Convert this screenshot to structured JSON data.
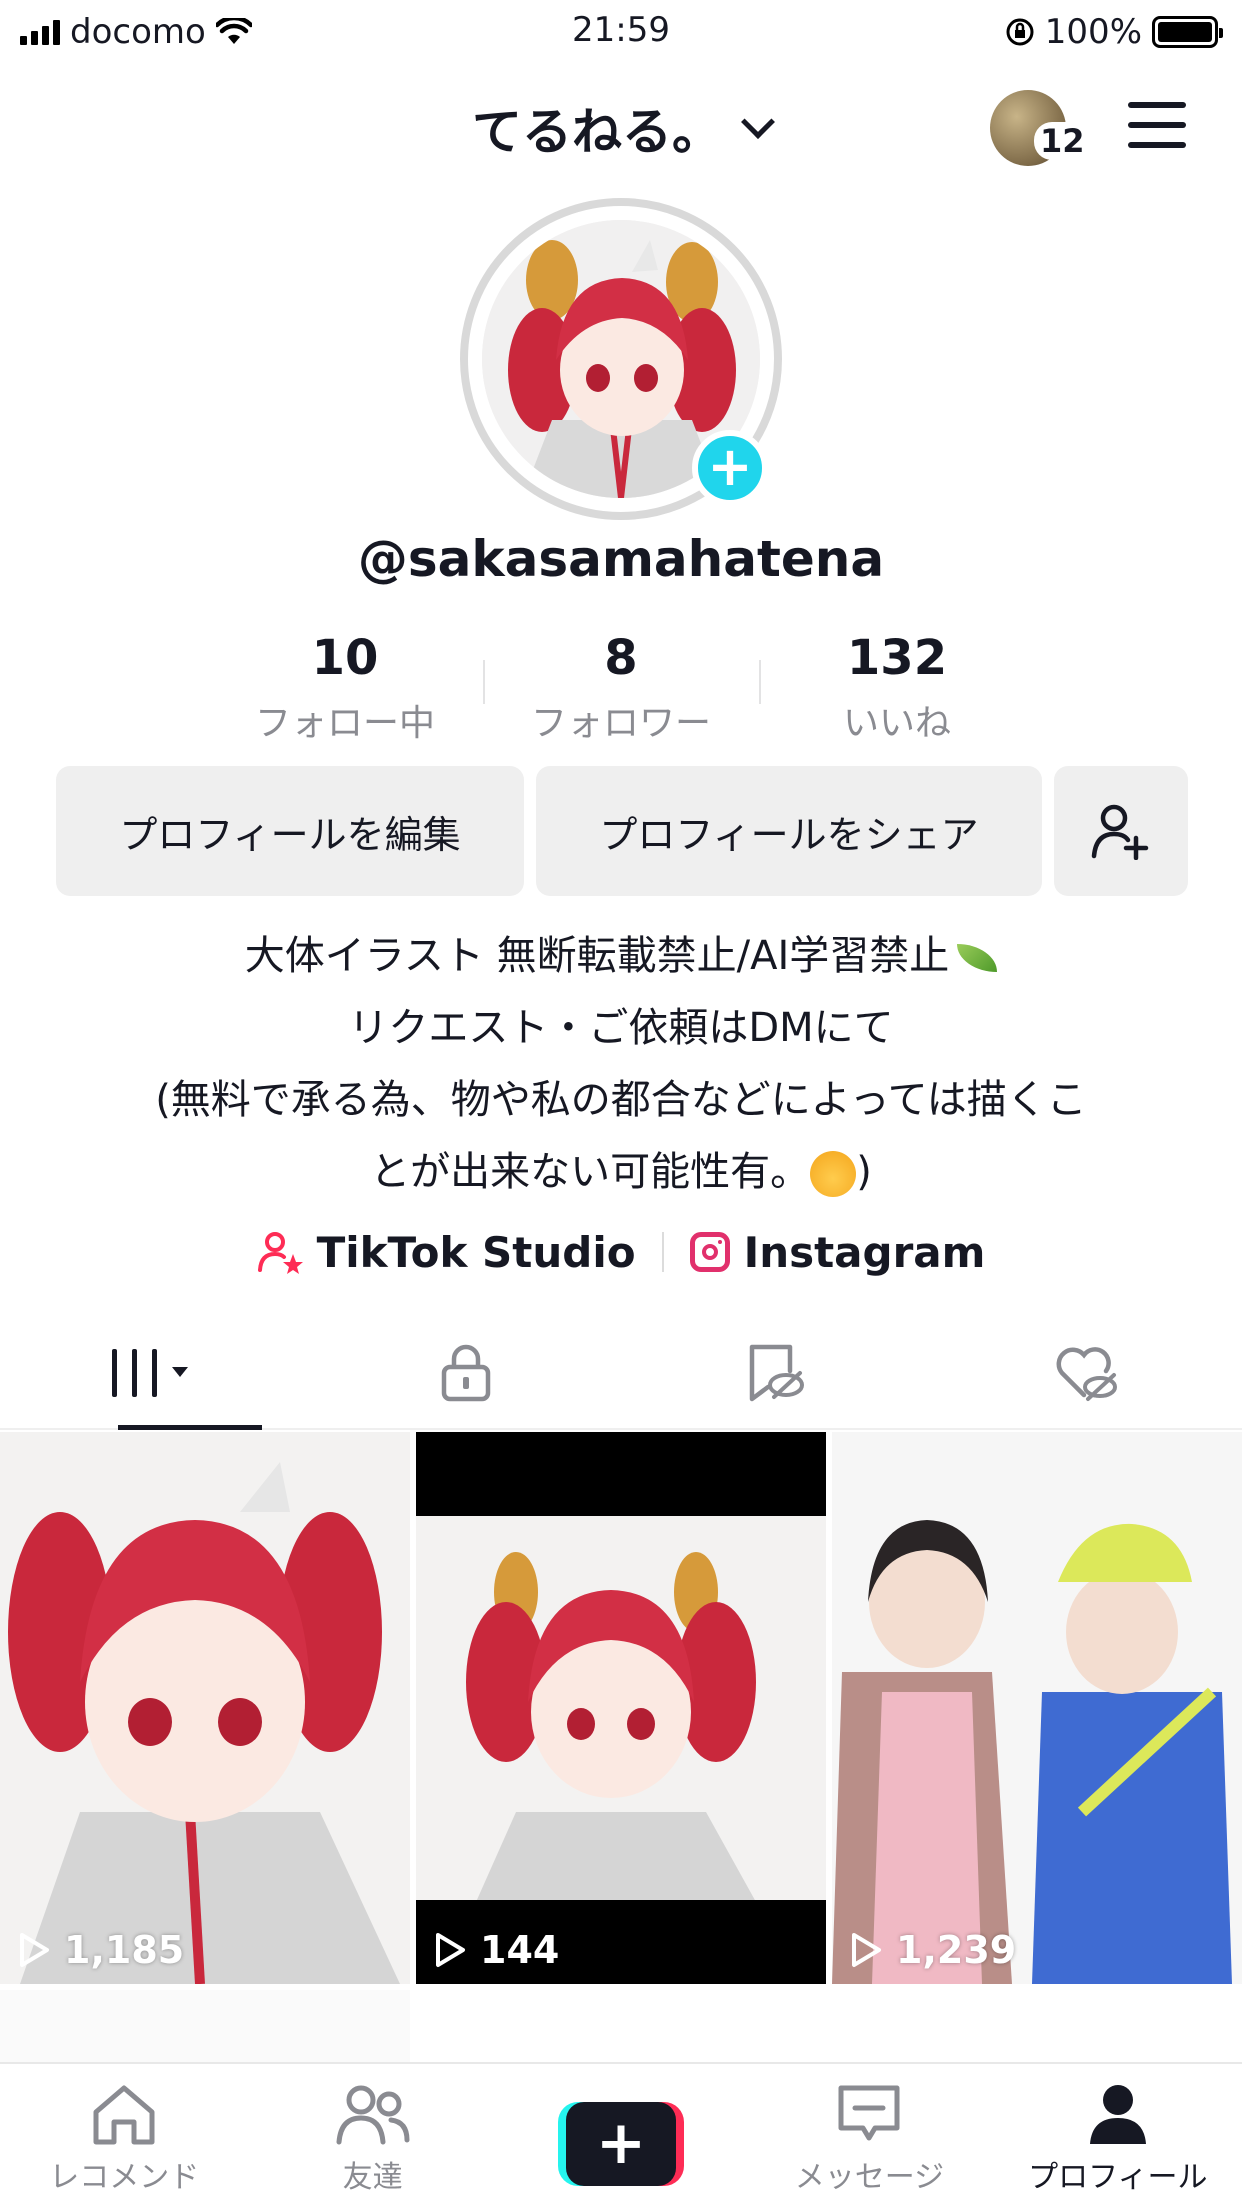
{
  "status_bar": {
    "carrier": "docomo",
    "time": "21:59",
    "battery": "100%"
  },
  "header": {
    "title": "てるねる。",
    "notification_count": "12"
  },
  "profile": {
    "username": "@sakasamahatena",
    "stats": [
      {
        "value": "10",
        "label": "フォロー中"
      },
      {
        "value": "8",
        "label": "フォロワー"
      },
      {
        "value": "132",
        "label": "いいね"
      }
    ],
    "buttons": {
      "edit": "プロフィールを編集",
      "share": "プロフィールをシェア"
    },
    "bio": [
      "大体イラスト 無断転載禁止/AI学習禁止",
      "リクエスト・ご依頼はDMにて",
      "(無料で承る為、物や私の都合などによっては描くこ",
      "とが出来ない可能性有。"
    ],
    "bio_tail": ")",
    "links": [
      {
        "label": "TikTok Studio",
        "icon": "person-star-icon"
      },
      {
        "label": "Instagram",
        "icon": "instagram-icon"
      }
    ]
  },
  "tabs": [
    {
      "name": "videos-grid",
      "icon": "grid-icon",
      "active": true
    },
    {
      "name": "private",
      "icon": "lock-icon",
      "active": false
    },
    {
      "name": "hidden-reposts",
      "icon": "hidden-icon",
      "active": false
    },
    {
      "name": "liked",
      "icon": "heart-hidden-icon",
      "active": false
    }
  ],
  "videos": [
    {
      "views": "1,185"
    },
    {
      "views": "144"
    },
    {
      "views": "1,239"
    }
  ],
  "bottom_nav": [
    {
      "label": "レコメンド",
      "icon": "home-icon"
    },
    {
      "label": "友達",
      "icon": "friends-icon"
    },
    {
      "label": "",
      "icon": "plus-icon"
    },
    {
      "label": "メッセージ",
      "icon": "message-icon"
    },
    {
      "label": "プロフィール",
      "icon": "profile-icon",
      "active": true
    }
  ],
  "colors": {
    "accent_cyan": "#20d5ec",
    "tiktok_red": "#fe2c55",
    "tiktok_cyan": "#25f4ee",
    "instagram": "#e1306c",
    "text_primary": "#161823",
    "text_secondary": "#8a8b91"
  }
}
